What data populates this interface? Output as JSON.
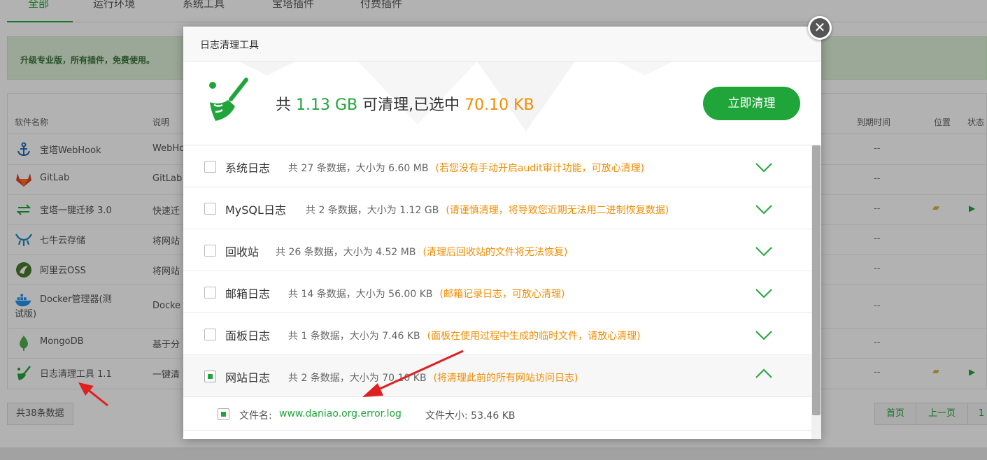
{
  "tabs": [
    "全部",
    "运行环境",
    "系统工具",
    "宝塔插件",
    "付费插件"
  ],
  "promo_text": "升级专业版，所有插件，免费使用。",
  "table": {
    "headers": {
      "name": "软件名称",
      "desc": "说明",
      "expire": "到期时间",
      "location": "位置",
      "status": "状态"
    },
    "rows": [
      {
        "name": "宝塔WebHook",
        "desc": "WebHo",
        "expire": "--",
        "icon": "anchor-icon",
        "icon_color": "#1e6fb8"
      },
      {
        "name": "GitLab",
        "desc": "GitLab",
        "expire": "--",
        "icon": "gitlab-icon",
        "icon_color": "#e24329"
      },
      {
        "name": "宝塔一键迁移 3.0",
        "desc": "快速迁",
        "expire": "--",
        "icon": "migrate-icon",
        "icon_color": "#20a53a",
        "folder": true,
        "play": true
      },
      {
        "name": "七牛云存储",
        "desc": "将网站",
        "expire": "--",
        "icon": "qiniu-icon",
        "icon_color": "#1e88c8"
      },
      {
        "name": "阿里云OSS",
        "desc": "将网站",
        "expire": "--",
        "icon": "oss-icon",
        "icon_color": "#4a7a2e"
      },
      {
        "name": "Docker管理器(测试版)",
        "desc": "Docke",
        "expire": "--",
        "icon": "docker-icon",
        "icon_color": "#2496ed"
      },
      {
        "name": "MongoDB",
        "desc": "基于分",
        "expire": "--",
        "icon": "mongodb-icon",
        "icon_color": "#4caf50"
      },
      {
        "name": "日志清理工具 1.1",
        "desc": "一键清",
        "expire": "--",
        "icon": "broom-icon",
        "icon_color": "#20a53a",
        "folder": true,
        "play": true
      }
    ]
  },
  "total_text": "共38条数据",
  "pager": {
    "first": "首页",
    "prev": "上一页",
    "page": "1"
  },
  "modal": {
    "title": "日志清理工具",
    "summary": {
      "prefix": "共 ",
      "total": "1.13 GB",
      "mid": " 可清理,已选中 ",
      "selected": "70.10 KB"
    },
    "clean_button": "立即清理",
    "items": [
      {
        "name": "系统日志",
        "info": "共 27 条数据，大小为 6.60 MB",
        "note": "(若您没有手动开启audit审计功能，可放心清理)",
        "checked": false,
        "expanded": false
      },
      {
        "name": "MySQL日志",
        "info": "共 2 条数据，大小为 1.12 GB",
        "note": "(请谨慎清理，将导致您近期无法用二进制恢复数据)",
        "checked": false,
        "expanded": false
      },
      {
        "name": "回收站",
        "info": "共 26 条数据，大小为 4.52 MB",
        "note": "(清理后回收站的文件将无法恢复)",
        "checked": false,
        "expanded": false
      },
      {
        "name": "邮箱日志",
        "info": "共 14 条数据，大小为 56.00 KB",
        "note": "(邮箱记录日志，可放心清理)",
        "checked": false,
        "expanded": false
      },
      {
        "name": "面板日志",
        "info": "共 1 条数据，大小为 7.46 KB",
        "note": "(面板在使用过程中生成的临时文件，请放心清理)",
        "checked": false,
        "expanded": false
      },
      {
        "name": "网站日志",
        "info": "共 2 条数据，大小为 70.10 KB",
        "note": "(将清理此前的所有网站访问日志)",
        "checked": true,
        "expanded": true
      }
    ],
    "sub_item": {
      "file_label": "文件名:",
      "file_name": "www.daniao.org.error.log",
      "size_label": "文件大小:",
      "size": "53.46 KB",
      "checked": true
    }
  },
  "colors": {
    "accent": "#20a53a",
    "warning": "#f08c00",
    "annotation_arrow": "#e02020"
  }
}
